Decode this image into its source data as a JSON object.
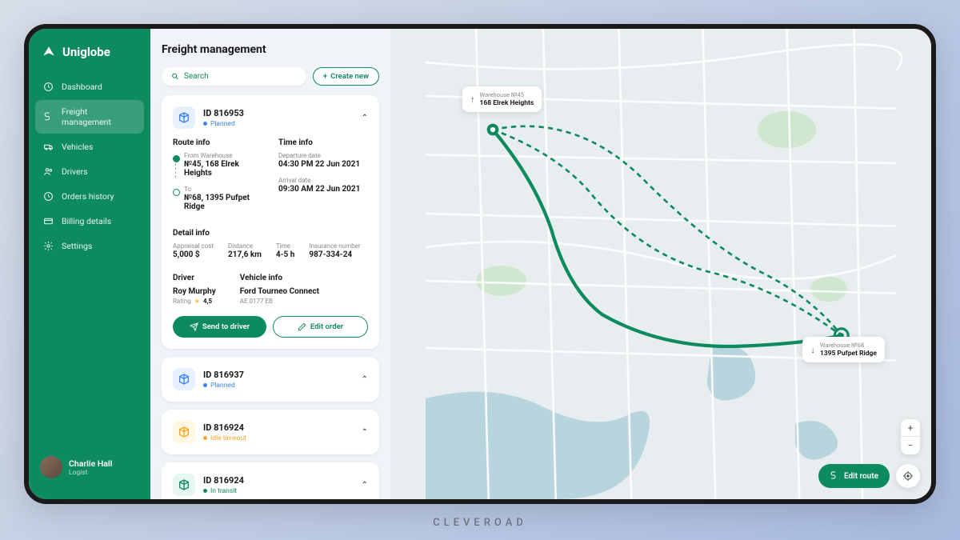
{
  "brand": "Uniglobe",
  "footer": "CLEVEROAD",
  "sidebar": {
    "items": [
      {
        "label": "Dashboard"
      },
      {
        "label": "Freight management"
      },
      {
        "label": "Vehicles"
      },
      {
        "label": "Drivers"
      },
      {
        "label": "Orders history"
      },
      {
        "label": "Billing details"
      },
      {
        "label": "Settings"
      }
    ]
  },
  "user": {
    "name": "Charlie Hall",
    "role": "Logist"
  },
  "page": {
    "title": "Freight management"
  },
  "search": {
    "placeholder": "Search"
  },
  "create_btn": "Create new",
  "expanded": {
    "id": "ID 816953",
    "status": "Planned",
    "route_info_label": "Route info",
    "time_info_label": "Time info",
    "from_label": "From Warehouse",
    "from_val": "№45, 168 Elrek Heights",
    "to_label": "To",
    "to_val": "№68, 1395 Pufpet Ridge",
    "dep_label": "Departure date",
    "dep_val": "04:30 PM  22 Jun 2021",
    "arr_label": "Arrival date",
    "arr_val": "09:30 AM  22 Jun 2021",
    "detail_label": "Detail info",
    "appraisal_label": "Appraisal cost",
    "appraisal_val": "5,000 $",
    "distance_label": "Distance",
    "distance_val": "217,6 km",
    "time_label": "Time",
    "time_val": "4-5 h",
    "insurance_label": "Insurance number",
    "insurance_val": "987-334-24",
    "driver_label": "Driver",
    "driver_name": "Roy Murphy",
    "rating_label": "Rating",
    "rating_val": "4,5",
    "vehicle_label": "Vehicle info",
    "vehicle_name": "Ford Tourneo Connect",
    "vehicle_plate": "AE 0177 EB",
    "send_btn": "Send to driver",
    "edit_btn": "Edit order"
  },
  "cards": [
    {
      "id": "ID 816937",
      "status": "Planned"
    },
    {
      "id": "ID 816924",
      "status": "Idle timeout"
    },
    {
      "id": "ID 816924",
      "status": "In transit"
    }
  ],
  "map": {
    "tooltip1_label": "Warehouse №45",
    "tooltip1_val": "168 Elrek Heights",
    "tooltip2_label": "Warehouse №68",
    "tooltip2_val": "1395 Pufpet Ridge",
    "edit_route": "Edit route"
  }
}
